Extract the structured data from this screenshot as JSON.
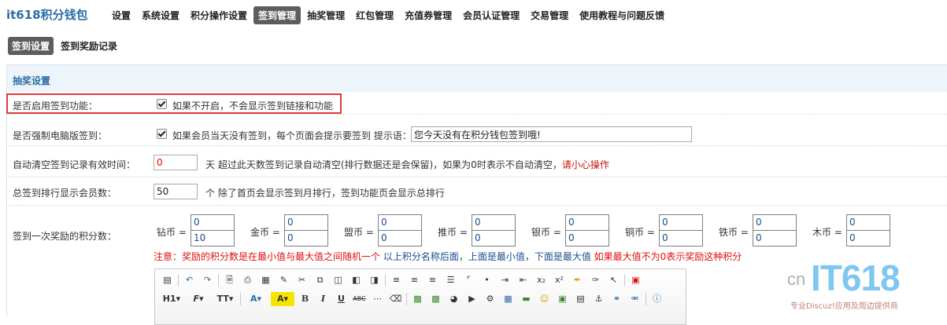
{
  "brand": "it618积分钱包",
  "nav": [
    "设置",
    "系统设置",
    "积分操作设置",
    "签到管理",
    "抽奖管理",
    "红包管理",
    "充值券管理",
    "会员认证管理",
    "交易管理",
    "使用教程与问题反馈"
  ],
  "nav_active": "签到管理",
  "subnav": [
    "签到设置",
    "签到奖励记录"
  ],
  "subnav_active": "签到设置",
  "panel_title": "抽奖设置",
  "rows": {
    "enable": {
      "label": "是否启用签到功能：",
      "checked": true,
      "desc": "如果不开启，不会显示签到链接和功能"
    },
    "force": {
      "label": "是否强制电脑版签到：",
      "checked": true,
      "desc": "如果会员当天没有签到，每个页面会提示要签到 提示语：",
      "prompt_value": "您今天没有在积分钱包签到哦!"
    },
    "clear": {
      "label": "自动清空签到记录有效时间：",
      "value": "0",
      "desc": "天 超过此天数签到记录自动清空(排行数据还是会保留)，如果为0时表示不自动清空，",
      "warn": "请小心操作"
    },
    "rank": {
      "label": "总签到排行显示会员数：",
      "value": "50",
      "desc": "个 除了首页会显示签到月排行，签到功能页会显示总排行"
    },
    "reward": {
      "label": "签到一次奖励的积分数："
    }
  },
  "coins": [
    {
      "label": "钻币 =",
      "min": "0",
      "max": "10"
    },
    {
      "label": "金币 =",
      "min": "0",
      "max": "0"
    },
    {
      "label": "盟币 =",
      "min": "0",
      "max": "0"
    },
    {
      "label": "推币 =",
      "min": "0",
      "max": "0"
    },
    {
      "label": "银币 =",
      "min": "0",
      "max": "0"
    },
    {
      "label": "铜币 =",
      "min": "0",
      "max": "0"
    },
    {
      "label": "铁币 =",
      "min": "0",
      "max": "0"
    },
    {
      "label": "木币 =",
      "min": "0",
      "max": "0"
    }
  ],
  "note": {
    "prefix": "注意：奖励的积分数是在最小值与最大值之间随机一个",
    "middle": " 以上积分名称后面，上面是最小值，下面是最大值 ",
    "suffix": "如果最大值不为0表示奖励这种积分"
  },
  "editor": {
    "heading_label": "H1",
    "font_label": "F",
    "size_label": "TT",
    "color_label": "A",
    "bgcolor_label": "A",
    "bold_label": "B",
    "italic_label": "I",
    "underline_label": "U",
    "strike_label": "ABC"
  },
  "logo": {
    "cn": "cn",
    "it": "IT618",
    "tag": "专业Discuz!应用及周边提供商"
  },
  "colors": {
    "accent": "#2b6ca6",
    "active_tab": "#5d5d5d",
    "highlight_border": "#e03a3a",
    "warn": "#d11111"
  }
}
